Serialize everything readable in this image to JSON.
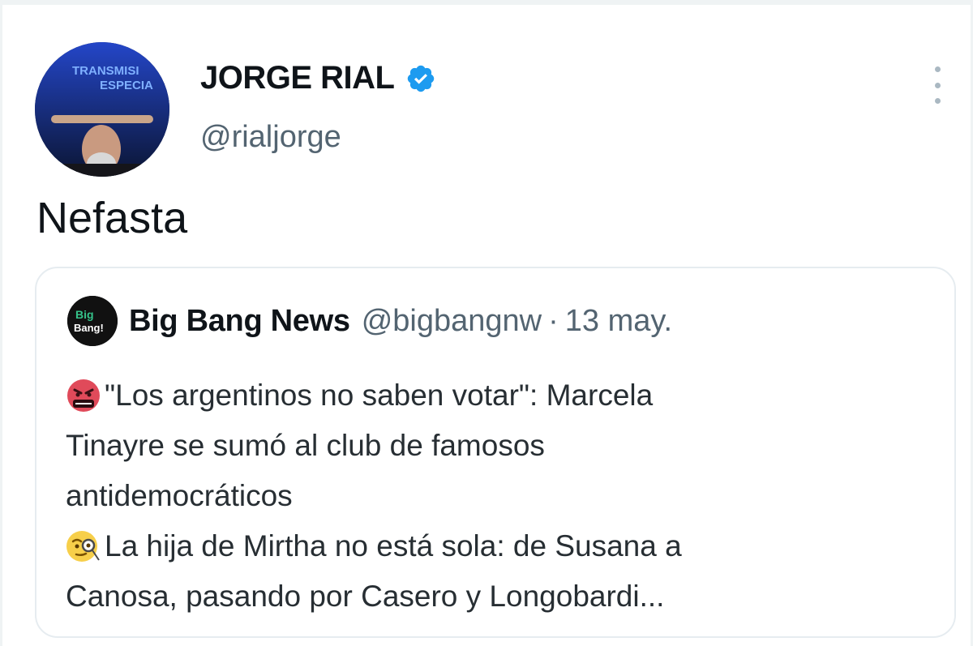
{
  "tweet": {
    "author": {
      "display_name": "JORGE RIAL",
      "handle": "@rialjorge",
      "avatar_text": "TRANSMISIÓN ESPECIAL",
      "verified_icon": "verified-badge-icon"
    },
    "text": "Nefasta",
    "more_icon": "more-options-icon"
  },
  "quoted_tweet": {
    "author": {
      "display_name": "Big Bang News",
      "handle": "@bigbangnw",
      "avatar_text": "Big Bang!"
    },
    "separator": "·",
    "date": "13 may.",
    "lines": [
      {
        "emoji": "angry-face-emoji",
        "text": "\"Los argentinos no saben votar\": Marcela"
      },
      {
        "emoji": "",
        "text": "Tinayre se sumó al club de famosos"
      },
      {
        "emoji": "",
        "text": "antidemocráticos"
      },
      {
        "emoji": "face-with-monocle-emoji",
        "text": "La hija de Mirtha no está sola: de Susana a"
      },
      {
        "emoji": "",
        "text": "Canosa, pasando por Casero y Longobardi..."
      }
    ]
  },
  "colors": {
    "primary_text": "#0f1419",
    "secondary_text": "#536471",
    "verified_blue": "#1d9bf0",
    "border": "#e6ecf0"
  }
}
